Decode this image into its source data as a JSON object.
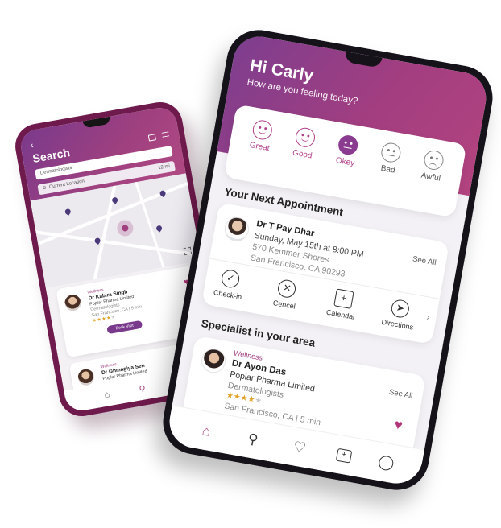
{
  "search_app": {
    "back_glyph": "‹",
    "title": "Search",
    "search_value": "Dermatologists",
    "location_label": "Current Location",
    "location_distance": "12 mi",
    "book_label": "Book Visit",
    "results": [
      {
        "tag": "Wellness",
        "name": "Dr Kabira Singh",
        "company": "Poplar Pharma Limited",
        "specialty": "Dermatologists",
        "location": "San Francisco, CA | 5 min",
        "rating": 4
      },
      {
        "tag": "Wellness",
        "name": "Dr Ghmagiya Sen",
        "company": "Poplar Pharma Limited"
      }
    ],
    "nav": [
      "home-icon",
      "search-icon",
      "heart-icon"
    ]
  },
  "home_app": {
    "greeting": "Hi Carly",
    "question": "How are you feeling today?",
    "moods": [
      {
        "label": "Great",
        "face": "smile",
        "style": "great"
      },
      {
        "label": "Good",
        "face": "smile",
        "style": "good"
      },
      {
        "label": "Okey",
        "face": "flat",
        "style": "okey"
      },
      {
        "label": "Bad",
        "face": "flat",
        "style": "bad"
      },
      {
        "label": "Awful",
        "face": "sad",
        "style": "awful"
      }
    ],
    "appointment_title": "Your Next Appointment",
    "see_all": "See All",
    "appointment": {
      "doctor": "Dr T Pay Dhar",
      "datetime": "Sunday, May 15th at 8:00 PM",
      "address1": "570 Kemmer Shores",
      "address2": "San Francisco, CA 90293"
    },
    "actions": [
      {
        "label": "Check-in",
        "icon": "check-icon",
        "glyph": "✓"
      },
      {
        "label": "Cencel",
        "icon": "cancel-icon",
        "glyph": "✕"
      },
      {
        "label": "Calendar",
        "icon": "calendar-icon",
        "glyph": "+"
      },
      {
        "label": "Directions",
        "icon": "directions-icon",
        "glyph": "➤"
      }
    ],
    "specialist_title": "Specialist in your area",
    "specialist": {
      "tag": "Wellness",
      "name": "Dr Ayon Das",
      "company": "Poplar Pharma Limited",
      "specialty": "Dermatologists",
      "location": "San Francisco, CA | 5 min",
      "rating": 4
    },
    "nav": [
      "home-icon",
      "search-icon",
      "heart-icon",
      "calendar-icon",
      "profile-icon"
    ]
  },
  "colors": {
    "brand": "#a0407f",
    "brand_dark": "#7a3a8c",
    "heart": "#b3357a",
    "star": "#e2a32a"
  }
}
